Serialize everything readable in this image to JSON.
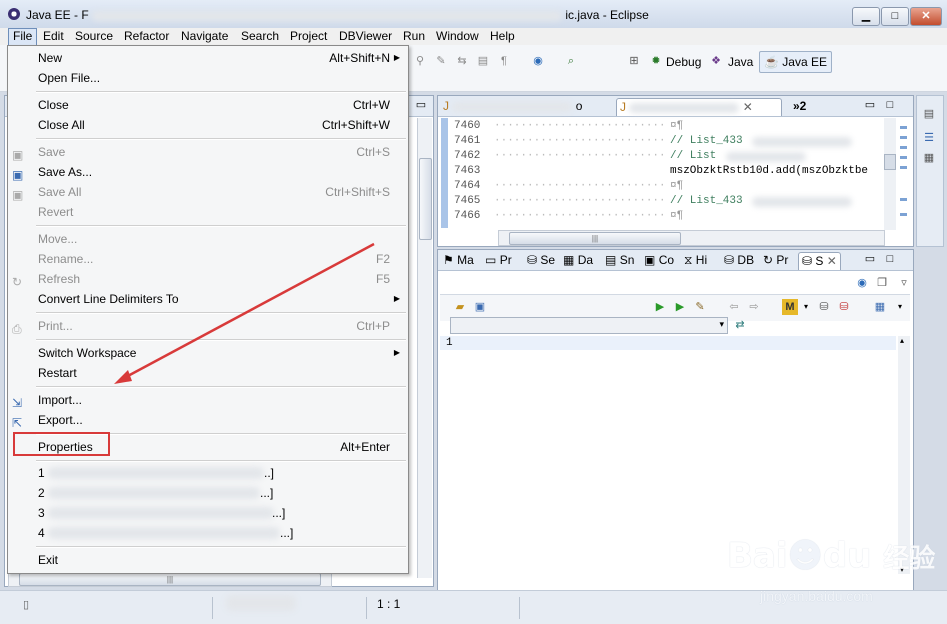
{
  "window": {
    "title_prefix": "Java EE - F",
    "title_suffix": "ic.java - Eclipse"
  },
  "menubar": [
    "File",
    "Edit",
    "Source",
    "Refactor",
    "Navigate",
    "Search",
    "Project",
    "DBViewer",
    "Run",
    "Window",
    "Help"
  ],
  "toolbar": {
    "debug": "Debug",
    "java": "Java",
    "javaee": "Java EE"
  },
  "file_menu": {
    "new": {
      "label": "New",
      "accel": "Alt+Shift+N"
    },
    "open_file": {
      "label": "Open File..."
    },
    "close": {
      "label": "Close",
      "accel": "Ctrl+W"
    },
    "close_all": {
      "label": "Close All",
      "accel": "Ctrl+Shift+W"
    },
    "save": {
      "label": "Save",
      "accel": "Ctrl+S"
    },
    "save_as": {
      "label": "Save As..."
    },
    "save_all": {
      "label": "Save All",
      "accel": "Ctrl+Shift+S"
    },
    "revert": {
      "label": "Revert"
    },
    "move": {
      "label": "Move..."
    },
    "rename": {
      "label": "Rename...",
      "accel": "F2"
    },
    "refresh": {
      "label": "Refresh",
      "accel": "F5"
    },
    "convert": {
      "label": "Convert Line Delimiters To"
    },
    "print": {
      "label": "Print...",
      "accel": "Ctrl+P"
    },
    "switch_ws": {
      "label": "Switch Workspace"
    },
    "restart": {
      "label": "Restart"
    },
    "import": {
      "label": "Import..."
    },
    "export": {
      "label": "Export..."
    },
    "properties": {
      "label": "Properties",
      "accel": "Alt+Enter"
    },
    "recent": [
      {
        "num": "1",
        "tail": "..]"
      },
      {
        "num": "2",
        "tail": "...]"
      },
      {
        "num": "3",
        "tail": "...]"
      },
      {
        "num": "4",
        "tail": "...]"
      }
    ],
    "exit": {
      "label": "Exit"
    }
  },
  "editor": {
    "tab_other": "o",
    "tab_more": "»2",
    "lines": [
      {
        "n": "7460",
        "text": "¤¶"
      },
      {
        "n": "7461",
        "text": "// List_433"
      },
      {
        "n": "7462",
        "text": "// List"
      },
      {
        "n": "7463",
        "text": "mszObzktRstb10d.add(mszObzktbe"
      },
      {
        "n": "7464",
        "text": "¤¶"
      },
      {
        "n": "7465",
        "text": "// List_433"
      },
      {
        "n": "7466",
        "text": "¤¶"
      }
    ]
  },
  "bottom_tabs": [
    "Ma",
    "Pr",
    "Se",
    "Da",
    "Sn",
    "Co",
    "Hi",
    "DB",
    "Pr",
    "S"
  ],
  "sql": {
    "line_number": "1"
  },
  "status": {
    "position": "1 : 1"
  },
  "watermark": {
    "brand": "Bai",
    "brand2": "du",
    "cn": "经验",
    "url": "jingyan.baidu.com"
  }
}
